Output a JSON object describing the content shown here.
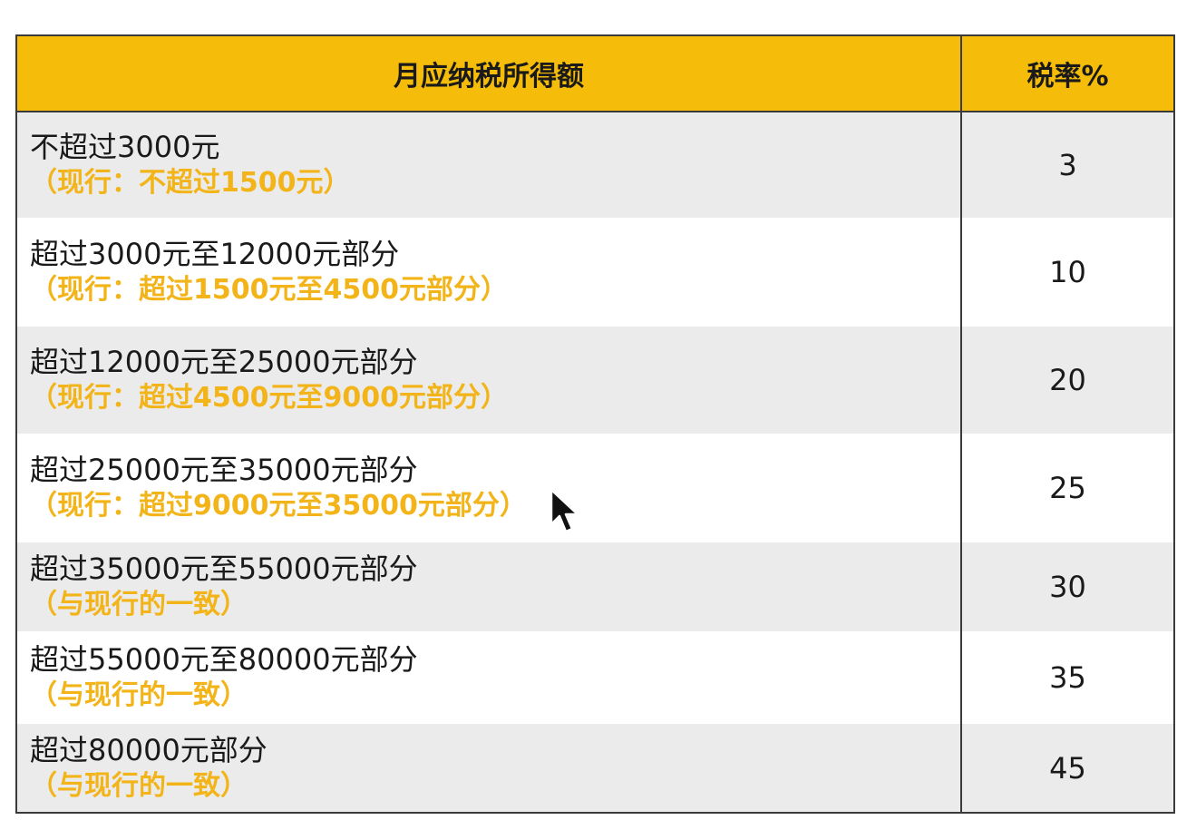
{
  "table": {
    "headers": {
      "range": "月应纳税所得额",
      "rate": "税率%"
    },
    "rows": [
      {
        "range": "不超过3000元",
        "note": "（现行：不超过1500元）",
        "rate": "3"
      },
      {
        "range": "超过3000元至12000元部分",
        "note": "（现行：超过1500元至4500元部分）",
        "rate": "10"
      },
      {
        "range": "超过12000元至25000元部分",
        "note": "（现行：超过4500元至9000元部分）",
        "rate": "20"
      },
      {
        "range": "超过25000元至35000元部分",
        "note": "（现行：超过9000元至35000元部分）",
        "rate": "25"
      },
      {
        "range": "超过35000元至55000元部分",
        "note": "（与现行的一致）",
        "rate": "30"
      },
      {
        "range": "超过55000元至80000元部分",
        "note": "（与现行的一致）",
        "rate": "35"
      },
      {
        "range": "超过80000元部分",
        "note": "（与现行的一致）",
        "rate": "45"
      }
    ]
  },
  "colors": {
    "header_bg": "#f5bd0a",
    "note_text": "#f2b418",
    "row_shade": "#ebebeb",
    "border": "#3a3a3a"
  },
  "icons": {
    "cursor": "mouse-pointer-icon"
  }
}
